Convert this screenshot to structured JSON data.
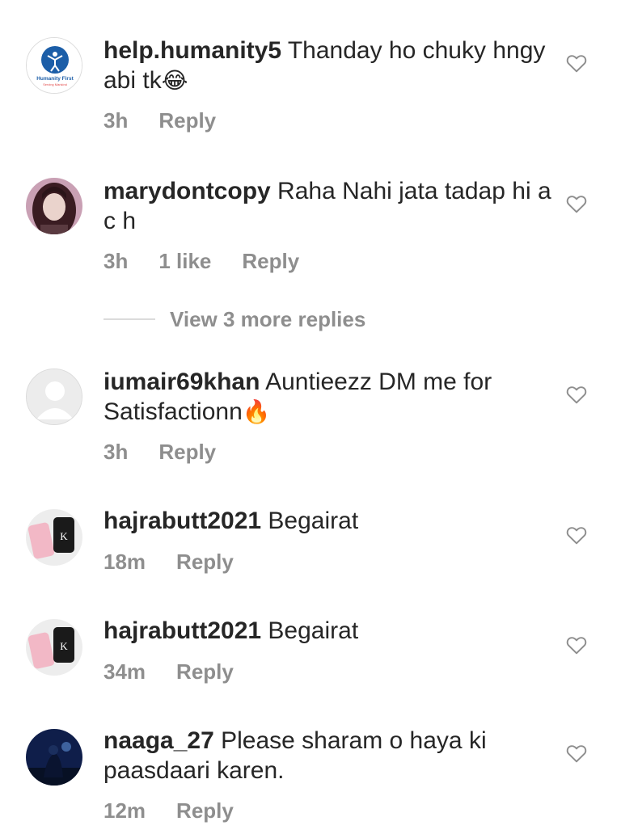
{
  "comments": [
    {
      "username": "help.humanity5",
      "text": " Thanday ho chuky hngy abi tk",
      "emoji": "😂",
      "time": "3h",
      "likes": "",
      "reply": "Reply",
      "avatar_text": "Humanity First",
      "avatar_subtext": "Serving Mankind"
    },
    {
      "username": "marydontcopy",
      "text": " Raha Nahi jata tadap hi a c h",
      "emoji": "",
      "time": "3h",
      "likes": "1 like",
      "reply": "Reply"
    },
    {
      "username": "iumair69khan",
      "text": " Auntieezz DM me for Satisfactionn",
      "emoji": "🔥",
      "time": "3h",
      "likes": "",
      "reply": "Reply"
    },
    {
      "username": "hajrabutt2021",
      "text": " Begairat",
      "emoji": "",
      "time": "18m",
      "likes": "",
      "reply": "Reply"
    },
    {
      "username": "hajrabutt2021",
      "text": " Begairat",
      "emoji": "",
      "time": "34m",
      "likes": "",
      "reply": "Reply"
    },
    {
      "username": "naaga_27",
      "text": " Please sharam o haya ki paasdaari karen.",
      "emoji": "",
      "time": "12m",
      "likes": "",
      "reply": "Reply"
    }
  ],
  "view_more_replies": "View 3 more replies",
  "colors": {
    "text": "#262626",
    "secondary": "#8e8e8e",
    "divider": "#dbdbdb",
    "brand_blue": "#1c5ea8"
  },
  "icons": {
    "like": "heart-outline-icon"
  }
}
